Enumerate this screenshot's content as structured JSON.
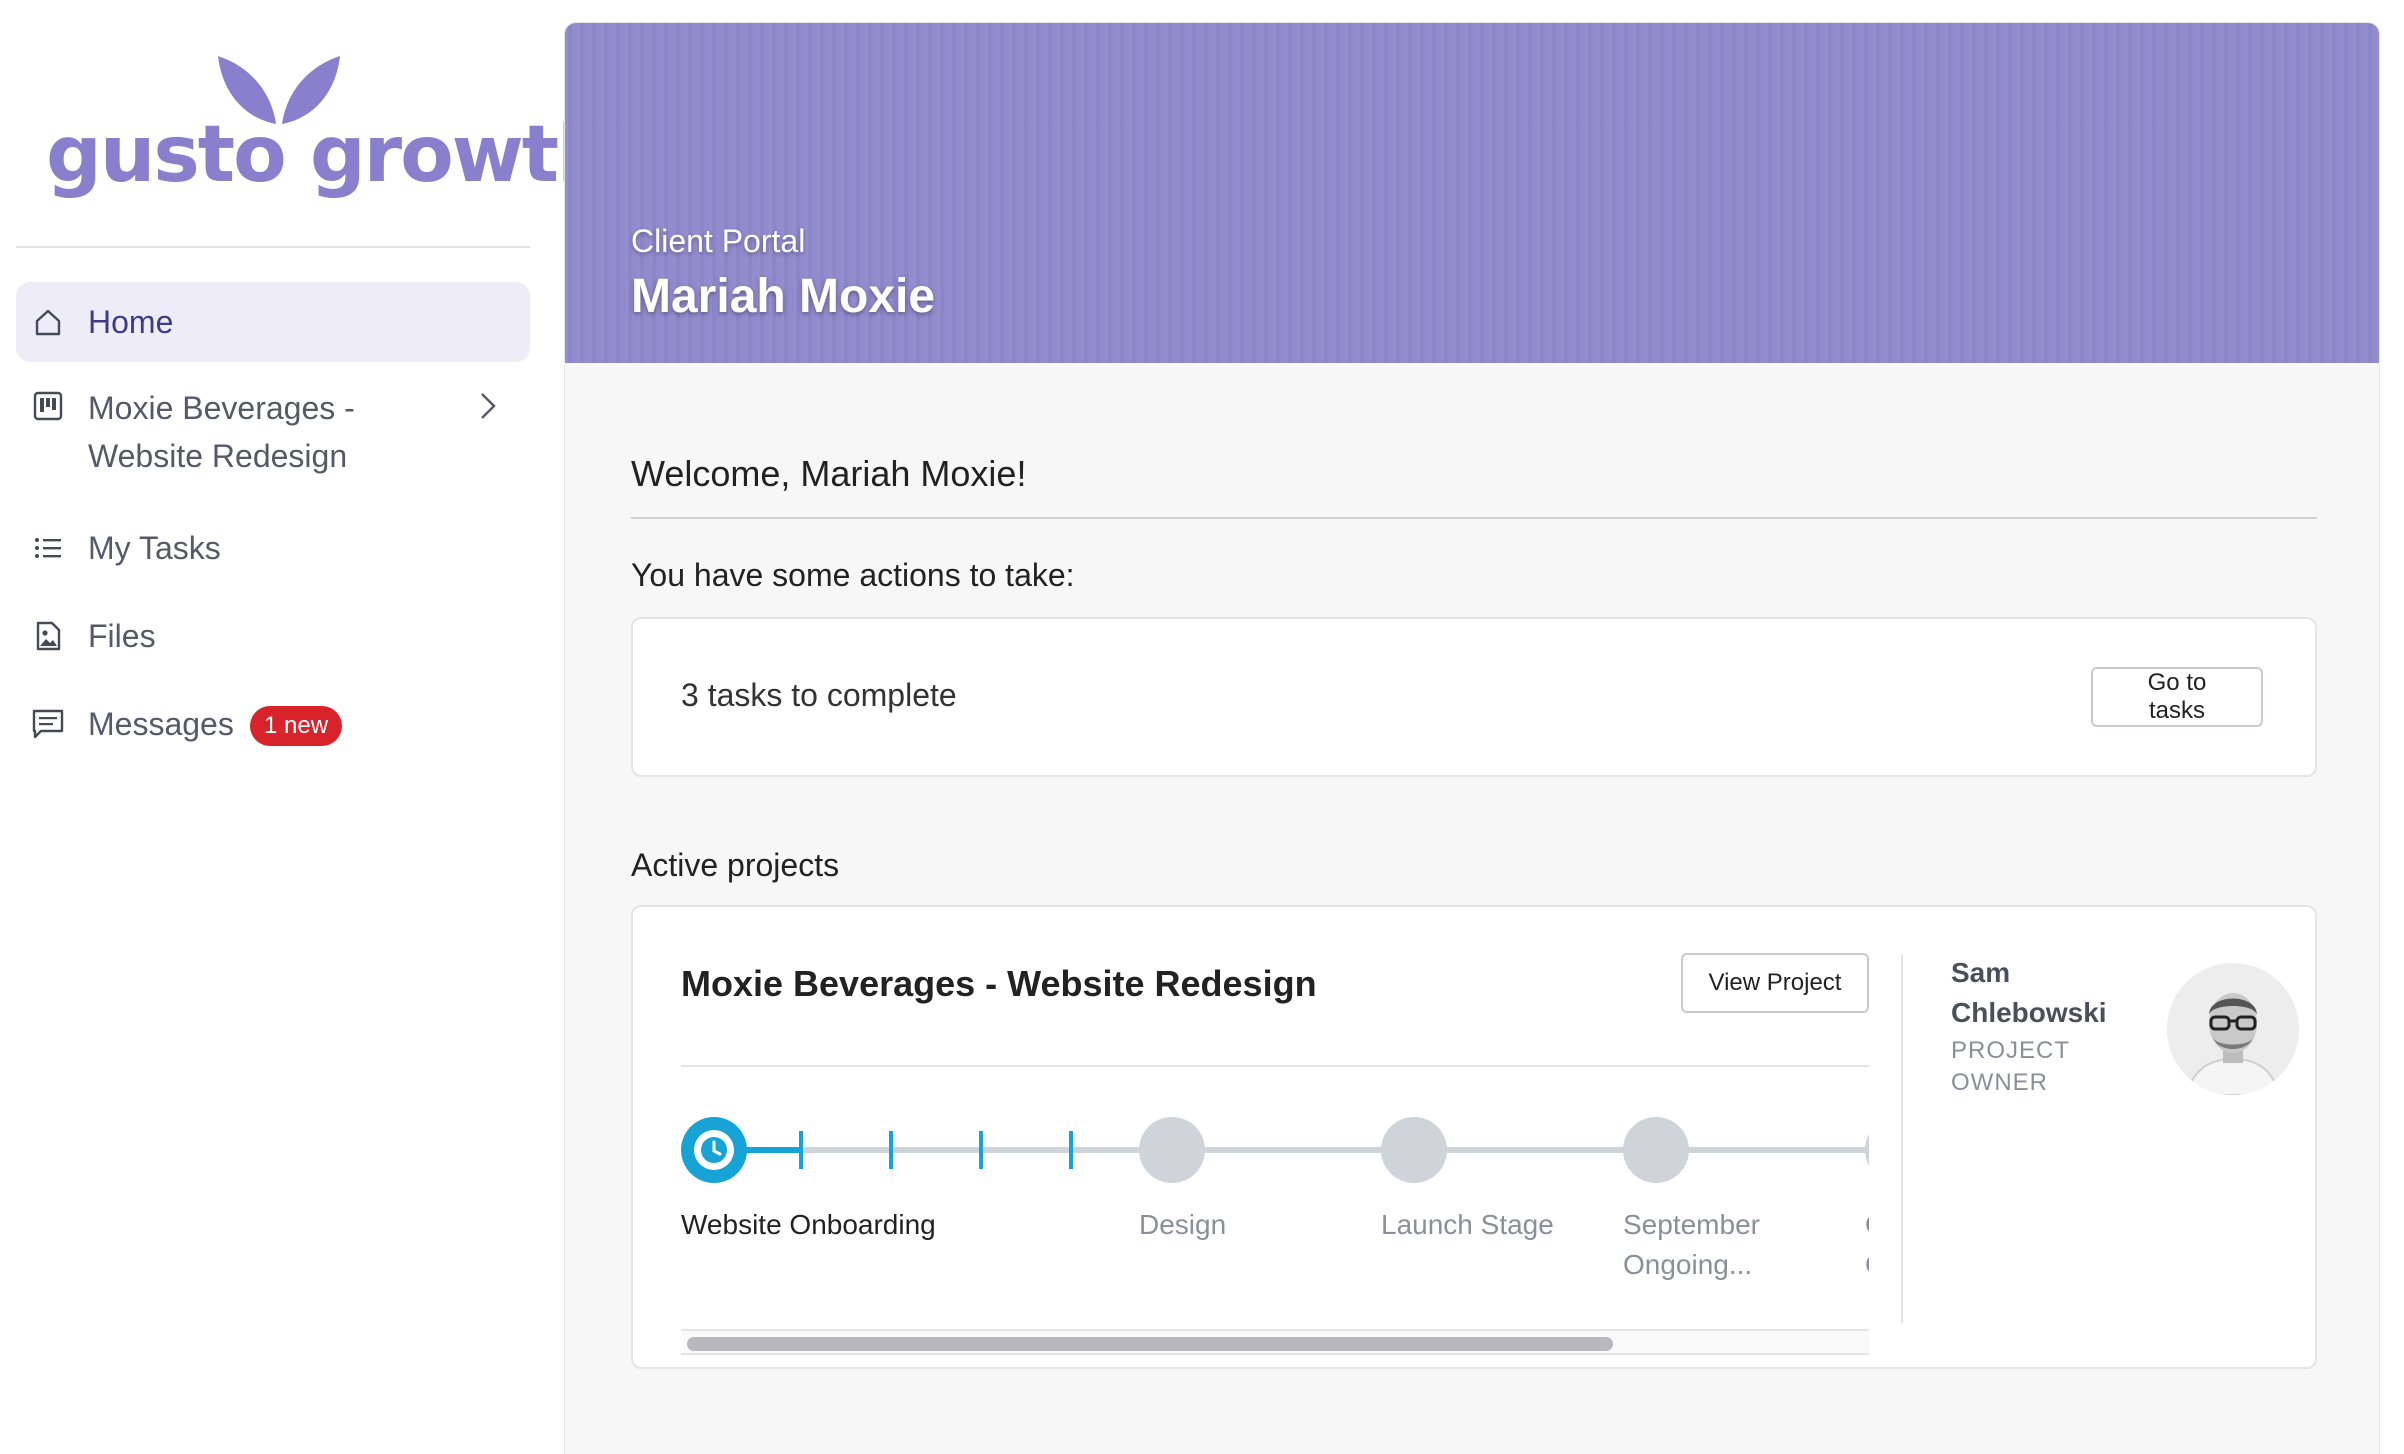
{
  "brand": {
    "logo_text": "gusto growth",
    "color": "#8a7fcd"
  },
  "sidebar": {
    "items": [
      {
        "label": "Home",
        "icon": "home-icon",
        "active": true
      },
      {
        "label": "Moxie Beverages - Website Redesign",
        "icon": "project-board-icon",
        "has_chevron": true
      },
      {
        "label": "My Tasks",
        "icon": "list-icon"
      },
      {
        "label": "Files",
        "icon": "image-file-icon"
      },
      {
        "label": "Messages",
        "icon": "message-icon",
        "badge": "1 new"
      }
    ]
  },
  "header": {
    "subtitle": "Client Portal",
    "title": "Mariah Moxie",
    "background": "#9089cc"
  },
  "main": {
    "welcome": "Welcome, Mariah Moxie!",
    "actions_label": "You have some actions to take:",
    "tasks_card": {
      "text": "3 tasks to complete",
      "button": "Go to tasks"
    },
    "active_projects_label": "Active projects",
    "project": {
      "title": "Moxie Beverages - Website Redesign",
      "button": "View Project",
      "owner": {
        "name": "Sam Chlebowski",
        "role": "PROJECT OWNER"
      },
      "stages": [
        {
          "label": "Website Onboarding",
          "current": true
        },
        {
          "label": "Design"
        },
        {
          "label": "Launch Stage"
        },
        {
          "label": "September Ongoing..."
        },
        {
          "label": "O O"
        }
      ],
      "accent_color": "#18a3d6"
    }
  }
}
